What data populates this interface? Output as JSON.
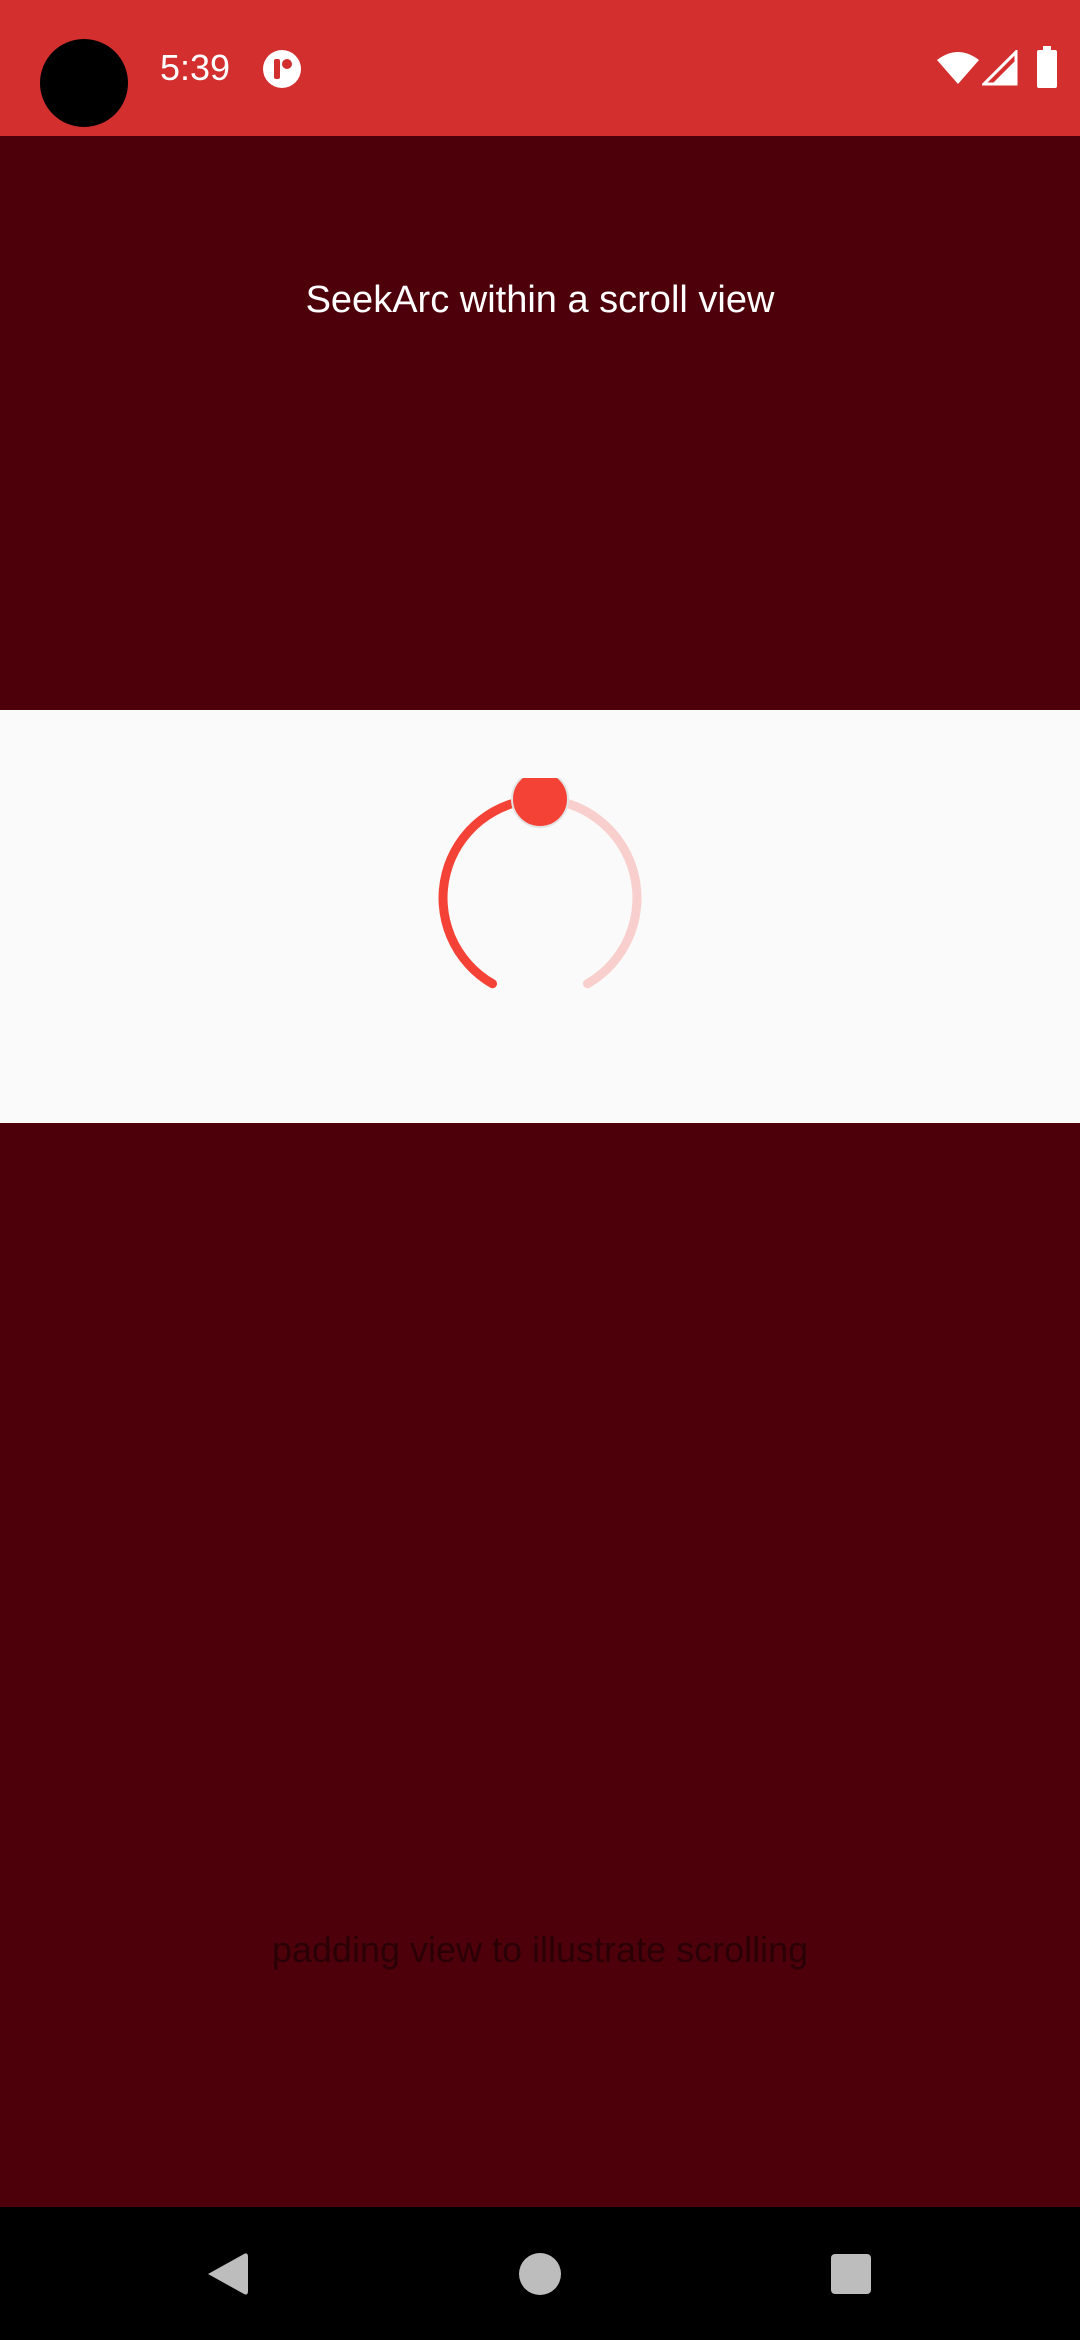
{
  "status_bar": {
    "time": "5:39",
    "icons": [
      "camera-cutout",
      "app-notification-icon",
      "wifi-icon",
      "cell-signal-icon",
      "battery-icon"
    ],
    "background_color": "#d32f2f"
  },
  "main": {
    "header_text": "SeekArc within a scroll view",
    "padding_text": "padding view to illustrate scrolling",
    "background_color": "#4e000a"
  },
  "seekarc": {
    "progress_fraction": 0.5,
    "progress_color": "#f44336",
    "track_color": "#f8cfcc",
    "thumb_color": "#f44336"
  },
  "nav_bar": {
    "icons": [
      "back-icon",
      "home-icon",
      "recents-icon"
    ]
  }
}
